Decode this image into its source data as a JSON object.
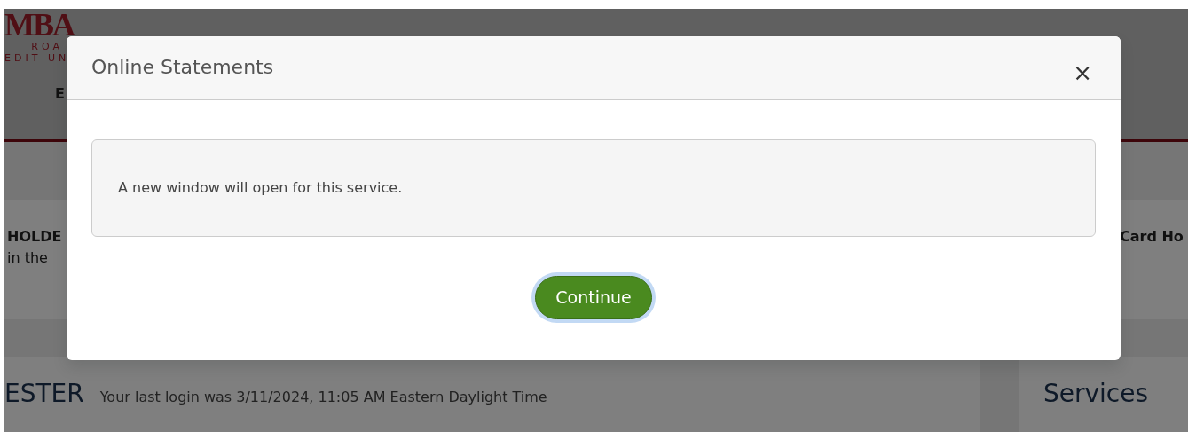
{
  "background_page": {
    "logo": {
      "wordmark": "MBA",
      "line_1": "ROA",
      "line_2": "EDIT UN"
    },
    "nav_item": "E",
    "alert_left": {
      "title": "HOLDE",
      "text": "in the"
    },
    "alert_right": {
      "title": "Card Ho"
    },
    "welcome": {
      "name": "ESTER",
      "last_login": "Your last login was 3/11/2024, 11:05 AM Eastern Daylight Time"
    },
    "services": {
      "title": "Services"
    }
  },
  "modal": {
    "title": "Online Statements",
    "close": "×",
    "message": "A new window will open for this service.",
    "buttons": [
      {
        "label": "Continue",
        "focused": true
      }
    ]
  }
}
